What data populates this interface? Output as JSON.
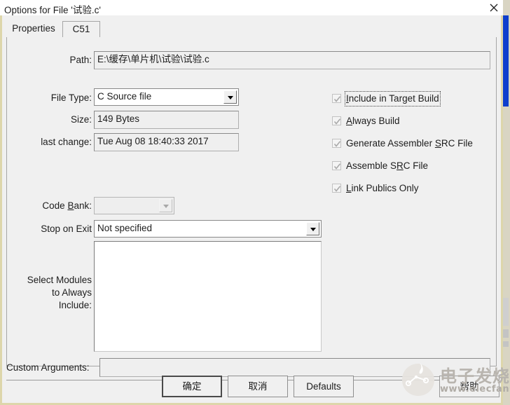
{
  "window": {
    "title": "Options for File '试验.c'",
    "close_icon": "close-icon"
  },
  "tabs": [
    {
      "label": "Properties",
      "active": true
    },
    {
      "label": "C51",
      "active": false
    }
  ],
  "form": {
    "path": {
      "label": "Path:",
      "value": "E:\\缓存\\单片机\\试验\\试验.c",
      "readonly": true
    },
    "file_type": {
      "label": "File Type:",
      "value": "C Source file",
      "options": [
        "C Source file"
      ]
    },
    "size": {
      "label": "Size:",
      "value": "149 Bytes",
      "readonly": true
    },
    "last_change": {
      "label": "last change:",
      "value": "Tue Aug 08 18:40:33 2017",
      "readonly": true
    },
    "code_bank": {
      "label_pre": "Code ",
      "label_accel": "B",
      "label_post": "ank:",
      "value": "",
      "disabled": true
    },
    "stop_on_exit": {
      "label": "Stop on Exit",
      "value": "Not specified",
      "options": [
        "Not specified"
      ]
    },
    "select_modules": {
      "label_lines": [
        "Select Modules",
        "to Always",
        "Include:"
      ],
      "value": ""
    },
    "custom_arguments": {
      "label": "Custom Arguments:",
      "value": "",
      "placeholder": ""
    }
  },
  "checkboxes": [
    {
      "pre": "",
      "accel": "I",
      "post": "nclude in Target Build",
      "checked": true,
      "disabled": true,
      "focused": true
    },
    {
      "pre": "",
      "accel": "A",
      "post": "lways Build",
      "checked": true,
      "disabled": true,
      "focused": false
    },
    {
      "pre": "Generate Assembler ",
      "accel": "S",
      "post": "RC File",
      "checked": true,
      "disabled": true,
      "focused": false
    },
    {
      "pre": "Assemble S",
      "accel": "R",
      "post": "C File",
      "checked": true,
      "disabled": true,
      "focused": false
    },
    {
      "pre": "",
      "accel": "L",
      "post": "ink Publics Only",
      "checked": true,
      "disabled": true,
      "focused": false
    }
  ],
  "buttons": {
    "ok": "确定",
    "cancel": "取消",
    "defaults": "Defaults",
    "help": "帮助"
  },
  "watermark": {
    "text": "电子发烧友",
    "url": "www.elecfans.com",
    "logo_icon": "circuit-logo-icon"
  },
  "colors": {
    "dialog_bg": "#f0f0f0",
    "dialog_border": "#ddd6ab",
    "title_bg": "#ffffff",
    "text": "#1d1d1d",
    "field_border": "#8a8a8a",
    "bg_app_blue": "#0d3fcd",
    "watermark": "#b8b4ae"
  }
}
